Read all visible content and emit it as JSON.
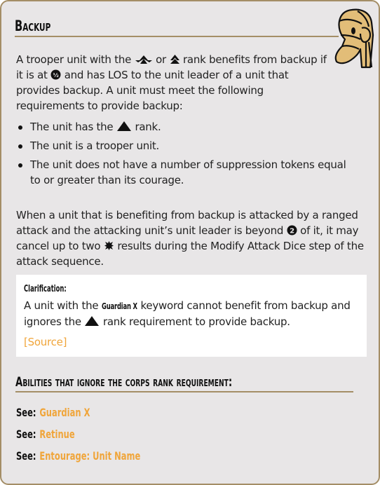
{
  "section": {
    "title": "Backup",
    "intro": {
      "part1": "A trooper unit with the ",
      "icon_a": "special-forces-rank-icon",
      "part2": " or ",
      "icon_b": "support-rank-icon",
      "part3": " rank benefits from backup if it is at ",
      "icon_c": "range-half-icon",
      "part4": " and has LOS to the unit leader of a unit that provides backup. A unit must meet the following requirements to provide backup:"
    },
    "requirements": [
      {
        "pre": "The unit has the ",
        "icon": "corps-rank-icon",
        "post": " rank."
      },
      {
        "pre": "The unit is a trooper unit.",
        "icon": "",
        "post": ""
      },
      {
        "pre": "The unit does not have a number of suppression tokens equal to or greater than its courage.",
        "icon": "",
        "post": ""
      }
    ],
    "effect": {
      "part1": "When a unit that is benefiting from backup is attacked by a ranged attack and the attacking unit’s unit leader is beyond ",
      "icon_range": "range-2-icon",
      "part2": " of it, it may cancel up to two ",
      "icon_hit": "hit-result-icon",
      "part3": " results during the Modify Attack Dice step of the attack sequence."
    }
  },
  "clarification": {
    "heading": "Clarification:",
    "part1": "A unit with the ",
    "keyword": "Guardian X",
    "part2": " keyword cannot benefit from backup and ignores the ",
    "icon": "corps-rank-icon",
    "part3": " rank requirement to provide backup.",
    "source_label": "[Source]"
  },
  "abilities": {
    "title": "Abilities that ignore the corps rank requirement:",
    "see_label": "See:",
    "links": [
      "Guardian X",
      "Retinue",
      "Entourage: Unit Name"
    ]
  },
  "colors": {
    "accent_link": "#f0a53a",
    "border": "#a48e66",
    "card_bg": "#e8e6e7",
    "droid_fill": "#e2bd78"
  }
}
